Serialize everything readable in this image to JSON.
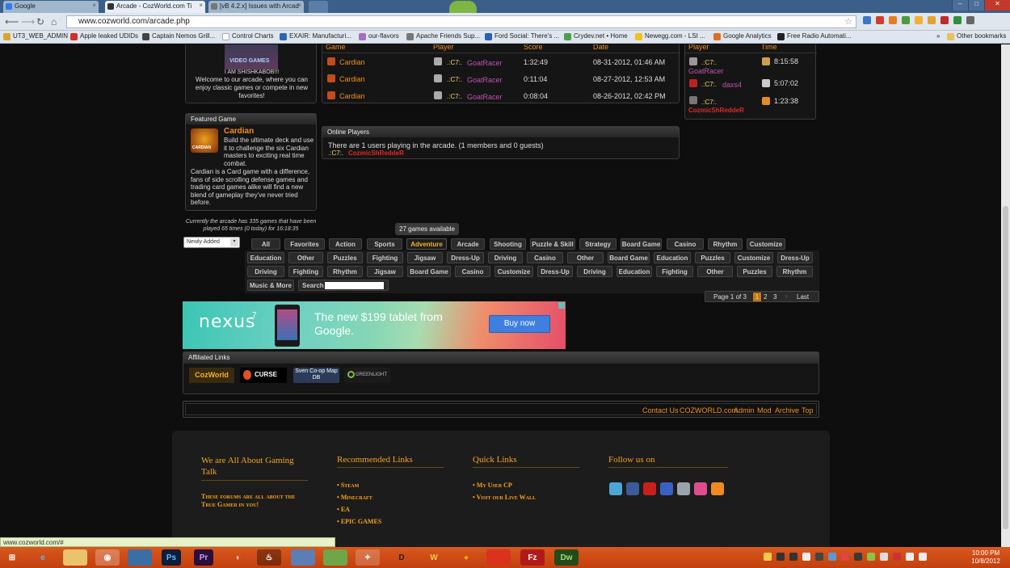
{
  "browser": {
    "tabs": [
      {
        "title": "Google",
        "active": false
      },
      {
        "title": "Arcade - CozWorld.com Ti",
        "active": true
      },
      {
        "title": "[vB 4.2.x] Issues with Arcad",
        "active": false
      }
    ],
    "url": "www.cozworld.com/arcade.php",
    "bookmarks": [
      "UT3_WEB_ADMIN",
      "Apple leaked UDIDs",
      "Captain Nemos Grill...",
      "Control Charts",
      "EXAIR: Manufacturi...",
      "our-flavors",
      "Apache Friends Sup...",
      "Ford Social: There's ...",
      "Crydev.net • Home",
      "Newegg.com - LSI ...",
      "Google Analytics",
      "Free Radio Automati..."
    ],
    "other_bookmarks": "Other bookmarks",
    "status_url": "www.cozworld.com/#"
  },
  "welcome": {
    "avatar_caption": "VIDEO GAMES",
    "user_line": "I AM SHISHKABOB!!!",
    "text": "Welcome to our arcade, where you can enjoy classic games or compete in new favorites!"
  },
  "recent_scores": {
    "columns": [
      "Game",
      "Player",
      "Score",
      "Date"
    ],
    "rows": [
      {
        "game": "Cardian",
        "clan": ".:C7:.",
        "player": "GoatRacer",
        "score": "1:32:49",
        "date": "08-31-2012, 01:46 AM"
      },
      {
        "game": "Cardian",
        "clan": ".:C7:.",
        "player": "GoatRacer",
        "score": "0:11:04",
        "date": "08-27-2012, 12:53 AM"
      },
      {
        "game": "Cardian",
        "clan": ".:C7:.",
        "player": "GoatRacer",
        "score": "0:08:04",
        "date": "08-26-2012, 02:42 PM"
      }
    ]
  },
  "top_players": {
    "columns": [
      "Player",
      "Time"
    ],
    "rows": [
      {
        "clan": ".:C7:.",
        "player": "GoatRacer",
        "time": "8:15:58"
      },
      {
        "clan": ".:C7:.",
        "player": "daxs4",
        "time": "5:07:02"
      },
      {
        "clan": ".:C7:.",
        "player": "CozmicShReddeR",
        "time": "1:23:38"
      }
    ]
  },
  "featured": {
    "title": "Featured Game",
    "game": "Cardian",
    "icon_label": "CARDIAN",
    "desc1": "Build the ultimate deck and use it to challenge the six Cardian masters to exciting real time combat.",
    "desc2": "Cardian is a Card game with a difference, fans of side scrolling defense games and trading card games alike will find a new blend of gameplay they've never tried before."
  },
  "online": {
    "title": "Online Players",
    "text": "There are 1 users playing in the arcade. (1 members and 0 guests)",
    "clan": ".:C7:.",
    "member": "CozmicShReddeR"
  },
  "stats_text": "Currently the arcade has 335 games that have been played 65 times (0 today) for 16:18:35",
  "sort_select": "Newly Added",
  "games_available": "27 games available",
  "categories": {
    "row1": [
      "All",
      "Favorites",
      "Action",
      "Sports",
      "Adventure",
      "Arcade",
      "Shooting",
      "Puzzle & Skill",
      "Strategy",
      "Board Game",
      "Casino",
      "Rhythm",
      "Customize"
    ],
    "row2": [
      "Education",
      "Other",
      "Puzzles",
      "Fighting",
      "Jigsaw",
      "Dress-Up",
      "Driving",
      "Casino",
      "Other",
      "Board Game",
      "Education",
      "Puzzles",
      "Customize",
      "Dress-Up"
    ],
    "row3": [
      "Driving",
      "Fighting",
      "Rhythm",
      "Jigsaw",
      "Board Game",
      "Casino",
      "Customize",
      "Dress-Up",
      "Driving",
      "Education",
      "Fighting",
      "Other",
      "Puzzles",
      "Rhythm"
    ],
    "row4": [
      "Music & More"
    ],
    "search_label": "Search",
    "active": "Adventure"
  },
  "pagination": {
    "label": "Page 1 of 3",
    "pages": [
      "1",
      "2",
      "3"
    ],
    "current": "1",
    "last": "Last"
  },
  "ad": {
    "brand": "nexus",
    "brand_sup": "7",
    "headline": "The new $199 tablet from Google.",
    "button": "Buy now"
  },
  "affiliated": {
    "title": "Affiliated Links",
    "items": [
      "CozWorld",
      "CURSE",
      "Sven Co-op Map DB",
      "GREENLIGHT"
    ]
  },
  "footer_links": [
    "Contact Us",
    "COZWORLD.com",
    "Admin",
    "Mod",
    "Archive",
    "Top"
  ],
  "footer": {
    "col1_title": "We are All About Gaming Talk",
    "col1_text": "These forums are all about the True Gamer in you!",
    "col2_title": "Recommended Links",
    "col2_links": [
      "Steam",
      "Minecraft",
      "EA",
      "EPIC GAMES"
    ],
    "col3_title": "Quick Links",
    "col3_links": [
      "My User CP",
      "Visit our Live Wall"
    ],
    "col4_title": "Follow us on",
    "social": [
      "twitter-icon",
      "facebook-icon",
      "youtube-icon",
      "flickr-icon",
      "delicious-icon",
      "dribbble-icon",
      "rss-icon"
    ]
  },
  "taskbar": {
    "time": "10:00 PM",
    "date": "10/8/2012"
  },
  "colors": {
    "accent": "#f0901c",
    "player": "#c054b0",
    "clan": "#ecd96a",
    "member": "#e02828",
    "taskbar": "#c8461a"
  }
}
